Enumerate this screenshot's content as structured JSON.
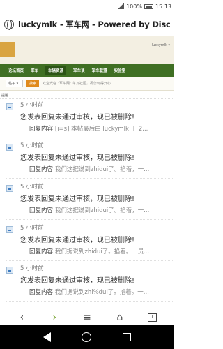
{
  "status_bar": {
    "battery": "100%",
    "time": "15:13"
  },
  "browser": {
    "tab_title": "luckymlk - 军车网 - Powered by Discuz!"
  },
  "site": {
    "nav": [
      "论坛首页",
      "军车",
      "车辆资源",
      "军车谈",
      "军车联盟",
      "实验室"
    ],
    "top_link": "luckymlk ▾",
    "sub_nav": {
      "select": "帖子 ▾",
      "go": "搜索",
      "notice": "欢迎光临 \"军车网\" 车友社区，祝您玩得开心"
    },
    "section_title": "提醒"
  },
  "notifications": [
    {
      "time": "5 小时前",
      "message": "您发表回复未通过审核，现已被删除!",
      "reply_label": "回复内容:",
      "reply_content": "[i=s] 本帖最后由 luckymlk 于 2..."
    },
    {
      "time": "5 小时前",
      "message": "您发表回复未通过审核，现已被删除!",
      "reply_label": "回复内容:",
      "reply_content": "我们这据说到zhidui了。掐着，一..."
    },
    {
      "time": "5 小时前",
      "message": "您发表回复未通过审核，现已被删除!",
      "reply_label": "回复内容:",
      "reply_content": "我们这据说到zhidui了。掐着，一..."
    },
    {
      "time": "5 小时前",
      "message": "您发表回复未通过审核，现已被删除!",
      "reply_label": "回复内容:",
      "reply_content": "我们据说到zhidui了。掐着。一员..."
    },
    {
      "time": "5 小时前",
      "message": "您发表回复未通过审核，现已被删除!",
      "reply_label": "回复内容:",
      "reply_content": "我们据说到zhi%dui了。掐着。一..."
    }
  ],
  "toolbar": {
    "tab_count": "1"
  },
  "icons": {
    "back": "chevron-left-icon",
    "forward": "chevron-right-icon",
    "menu": "menu-icon",
    "home": "home-icon",
    "tabs": "tabs-icon"
  },
  "colors": {
    "nav_green": "#3f6f23",
    "forward_green": "#6c9a1e"
  }
}
